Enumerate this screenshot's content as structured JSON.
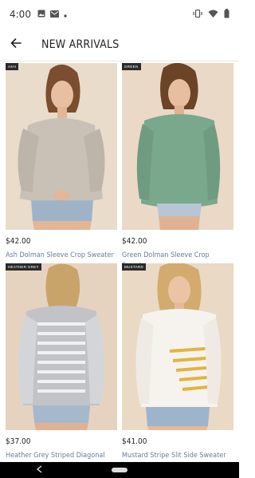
{
  "status_bar": {
    "time": "4:00",
    "left_icons": [
      "image-icon",
      "mail-icon",
      "dot-icon"
    ],
    "right_icons": [
      "vibrate-icon",
      "wifi-icon",
      "battery-icon"
    ]
  },
  "header": {
    "title": "NEW ARRIVALS",
    "back_icon": "arrow-left-icon"
  },
  "products": [
    {
      "tag": "ASH",
      "price": "$42.00",
      "name": "Ash Dolman Sleeve Crop Sweater",
      "sweater_color": "#c9c0b6",
      "bg_color": "#e9dccb"
    },
    {
      "tag": "GREEN",
      "price": "$42.00",
      "name": "Green Dolman Sleeve Crop Sweater",
      "sweater_color": "#7aa88c",
      "bg_color": "#ead9c6"
    },
    {
      "tag": "HEATHER GREY",
      "price": "$37.00",
      "name": "Heather Grey Striped Diagonal Hem Sweatshirt",
      "sweater_color": "#c2c3c7",
      "bg_color": "#e6d3bf"
    },
    {
      "tag": "MUSTARD",
      "price": "$41.00",
      "name": "Mustard Stripe Slit Side Sweater",
      "sweater_color": "#f6f3ee",
      "bg_color": "#ead9c5"
    }
  ],
  "colors": {
    "product_name": "#6a7c9a",
    "nav_bar": "#000000"
  }
}
